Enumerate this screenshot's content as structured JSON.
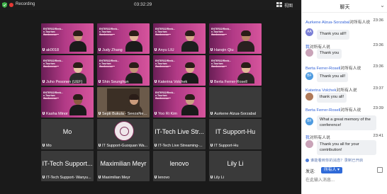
{
  "topbar": {
    "status": "Recording",
    "timer": "03:32:29",
    "view_label": "视图"
  },
  "tiles": [
    {
      "name": "ak0018",
      "kind": "pink",
      "slide": "ENTER22/Renk... e-Tourism Conference",
      "shirt": "#1b1b1b"
    },
    {
      "name": "Judy Zhang",
      "kind": "pink",
      "slide": "ENTER22/Renk... e-Tourism Conference",
      "shirt": "#1b1b1b"
    },
    {
      "name": "Anyu LIU",
      "kind": "pink",
      "slide": "ENTER22/Renk... e-Tourism Conference",
      "shirt": "#1e1e1e"
    },
    {
      "name": "Hanqin Qiu",
      "kind": "pink",
      "slide": "ENTER22/Renk... e-Tourism Conference",
      "shirt": "#2a2020"
    },
    {
      "name": "Juho Pesonen (UEF)",
      "kind": "pink",
      "slide": "ENTER22/Renk... e-Tourism Conference",
      "shirt": "#2b2b2b"
    },
    {
      "name": "Shin Seunghun",
      "kind": "pink",
      "slide": "ENTER22/Renk... e-Tourism Conference",
      "shirt": "#1f1f1f"
    },
    {
      "name": "Katerina Volchek",
      "kind": "pink",
      "slide": "ENTER22/Renk... e-Tourism Conference",
      "shirt": "#1a1a1a"
    },
    {
      "name": "Berta Ferrer-Rosell",
      "kind": "pink",
      "slide": "ENTER22/Renk... e-Tourism Conference",
      "shirt": "#2b2424"
    },
    {
      "name": "Kasha Minor",
      "kind": "pink",
      "slide": "ENTER22/Renk... e-Tourism Conference",
      "shirt": "#1a1a1a"
    },
    {
      "name": "Septi Bukula - SeezaNetwo...",
      "kind": "screen",
      "slide": "",
      "shirt": "#3b2f25"
    },
    {
      "name": "Yoo Ri Kim",
      "kind": "pink",
      "slide": "ENTER22/Renk... e-Tourism Conference",
      "shirt": "#1a1a1a"
    },
    {
      "name": "Aurkene Alzua-Sorzabal",
      "kind": "plain",
      "big": "",
      "shirt": ""
    },
    {
      "name": "Mo",
      "kind": "plain",
      "big": "Mo",
      "shirt": ""
    },
    {
      "name": "IT Support-Guoquan Wa...",
      "kind": "seal",
      "big": "",
      "shirt": ""
    },
    {
      "name": "IT-Tech Live Streaming-...",
      "kind": "plain",
      "big": "IT-Tech Live Str...",
      "shirt": ""
    },
    {
      "name": "IT Support-Hu",
      "kind": "plain",
      "big": "IT Support-Hu",
      "shirt": ""
    },
    {
      "name": "IT-Tech Support- Wanyu...",
      "kind": "plain",
      "big": "IT-Tech Support...",
      "shirt": ""
    },
    {
      "name": "Maximilian Meyr",
      "kind": "plain",
      "big": "Maximilian Meyr",
      "shirt": ""
    },
    {
      "name": "lenovo",
      "kind": "plain",
      "big": "lenovo",
      "shirt": ""
    },
    {
      "name": "Lily Li",
      "kind": "plain",
      "big": "Lily Li",
      "shirt": ""
    }
  ],
  "chat": {
    "title": "聊天",
    "messages": [
      {
        "sender": "Aurkene Alzua-Sorzabal",
        "to": "对所有人说",
        "time": "23:36",
        "avatar": "AA",
        "avatar_color": "#7a7fd6",
        "text": "Thank you all!!"
      },
      {
        "sender": "我",
        "to": "对所有人说",
        "time": "23:36",
        "avatar": "",
        "avatar_color": "#c9a3b8",
        "text": "Thank you"
      },
      {
        "sender": "Berta Ferrer-Rosell",
        "to": "对所有人说",
        "time": "23:36",
        "avatar": "BF",
        "avatar_color": "#4e9be0",
        "text": "Thank you all!"
      },
      {
        "sender": "Katerina Volchek",
        "to": "对所有人说",
        "time": "23:37",
        "avatar": "",
        "avatar_color": "#b07a5a",
        "text": "thank you all!"
      },
      {
        "sender": "Berta Ferrer-Rosell",
        "to": "对所有人说",
        "time": "23:39",
        "avatar": "BF",
        "avatar_color": "#4e9be0",
        "text": "What a great memory of the conference!"
      },
      {
        "sender": "我",
        "to": "对所有人说",
        "time": "23:41",
        "avatar": "",
        "avatar_color": "#c9a3b8",
        "text": "Thank you all for your contribution!"
      }
    ],
    "notice": "谁能看到你的消息？录制已开启",
    "send_to_label": "发送:",
    "recipient": "所有人",
    "input_placeholder": "在此输入消息..."
  }
}
